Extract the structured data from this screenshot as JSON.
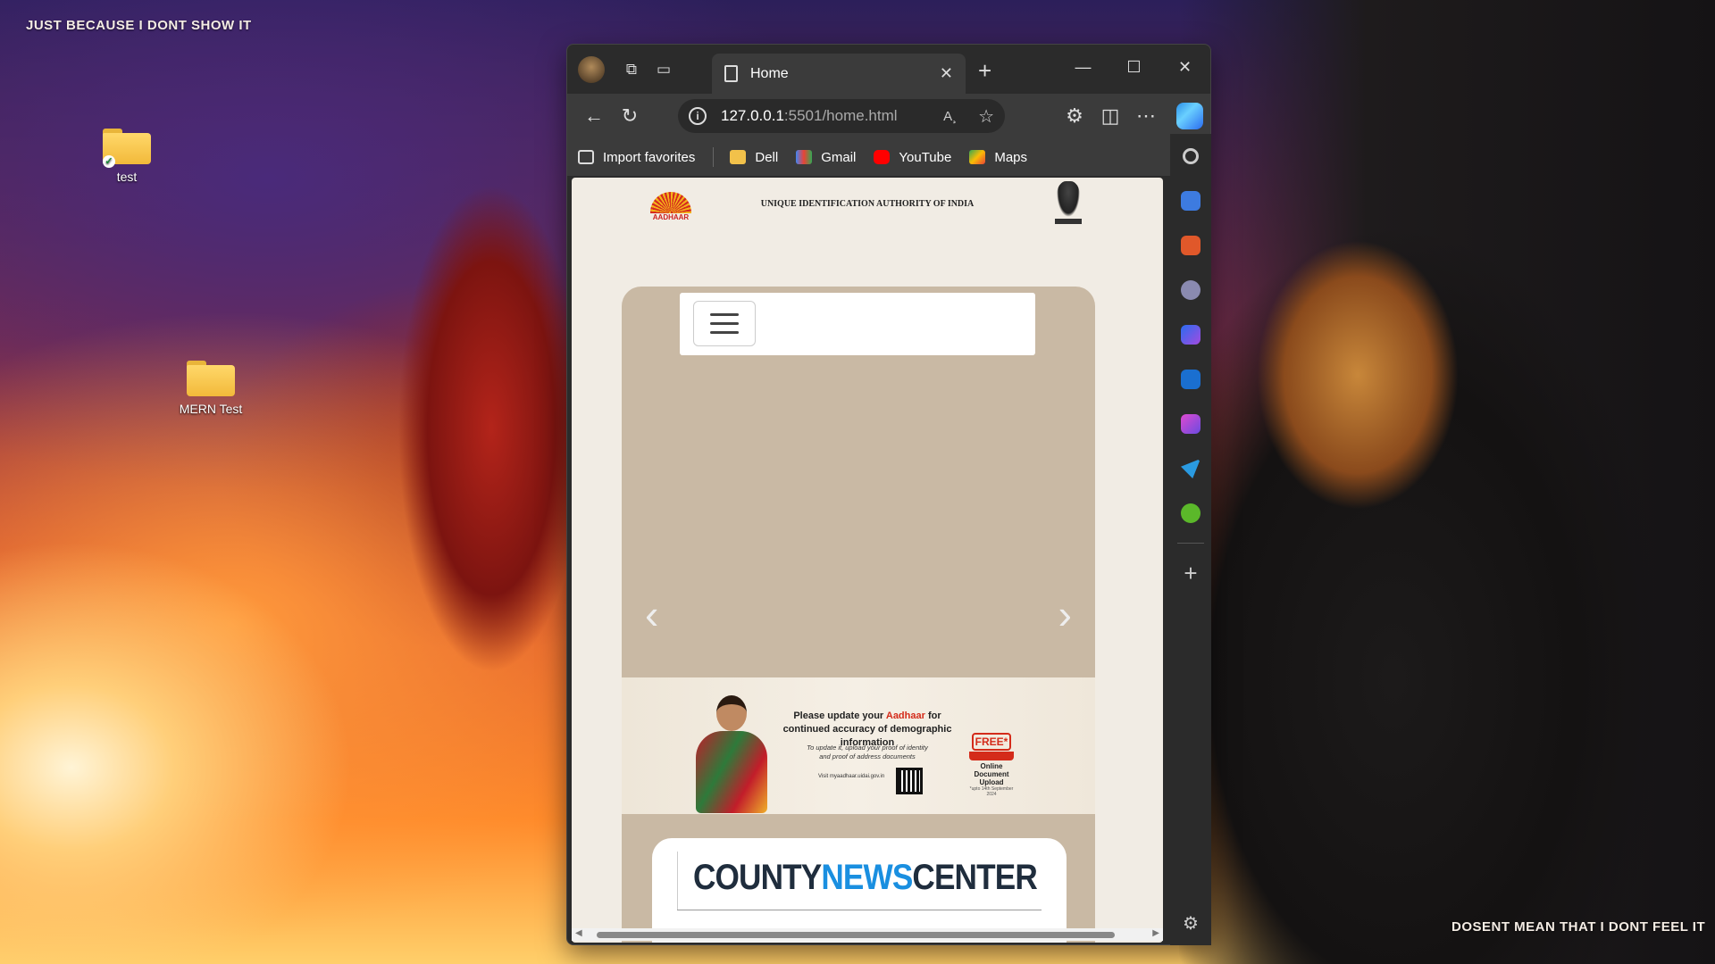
{
  "desktop": {
    "top_text": "JUST BECAUSE I DONT SHOW IT",
    "bottom_text": "DOSENT MEAN THAT I DONT FEEL IT",
    "icons": [
      {
        "label": "test",
        "icon": "folder-icon",
        "synced": true
      },
      {
        "label": "MERN Test",
        "icon": "folder-icon",
        "synced": false
      }
    ]
  },
  "browser": {
    "tab_title": "Home",
    "address_host": "127.0.0.1",
    "address_rest": ":5501/home.html",
    "read_aloud": "A¸",
    "favorites": [
      {
        "label": "Import favorites",
        "icon": "import-favorites-icon"
      },
      {
        "label": "Dell",
        "icon": "folder-icon"
      },
      {
        "label": "Gmail",
        "icon": "gmail-icon"
      },
      {
        "label": "YouTube",
        "icon": "youtube-icon"
      },
      {
        "label": "Maps",
        "icon": "maps-icon"
      }
    ],
    "sidebar_icons": [
      "search-icon",
      "shopping-tag-icon",
      "tools-icon",
      "games-icon",
      "copilot-icon",
      "outlook-icon",
      "designer-icon",
      "send-icon",
      "tree-icon",
      "add-icon",
      "settings-icon"
    ]
  },
  "page": {
    "header": {
      "logo_text": "AADHAAR",
      "org_name": "UNIQUE IDENTIFICATION AUTHORITY OF INDIA"
    },
    "banner": {
      "title_pre": "Please update your ",
      "title_highlight": "Aadhaar",
      "title_post": " for continued accuracy of demographic information",
      "subtitle": "To update it, upload your proof of identity and proof of address documents",
      "visit": "Visit myaadhaar.uidai.gov.in",
      "free_tag": "FREE*",
      "free_label": "Online Document Upload",
      "free_note": "*upto 14th September 2024"
    },
    "news": {
      "logo_part1": "COUNTY",
      "logo_part2": "NEWS",
      "logo_part3": "CENTER"
    }
  }
}
